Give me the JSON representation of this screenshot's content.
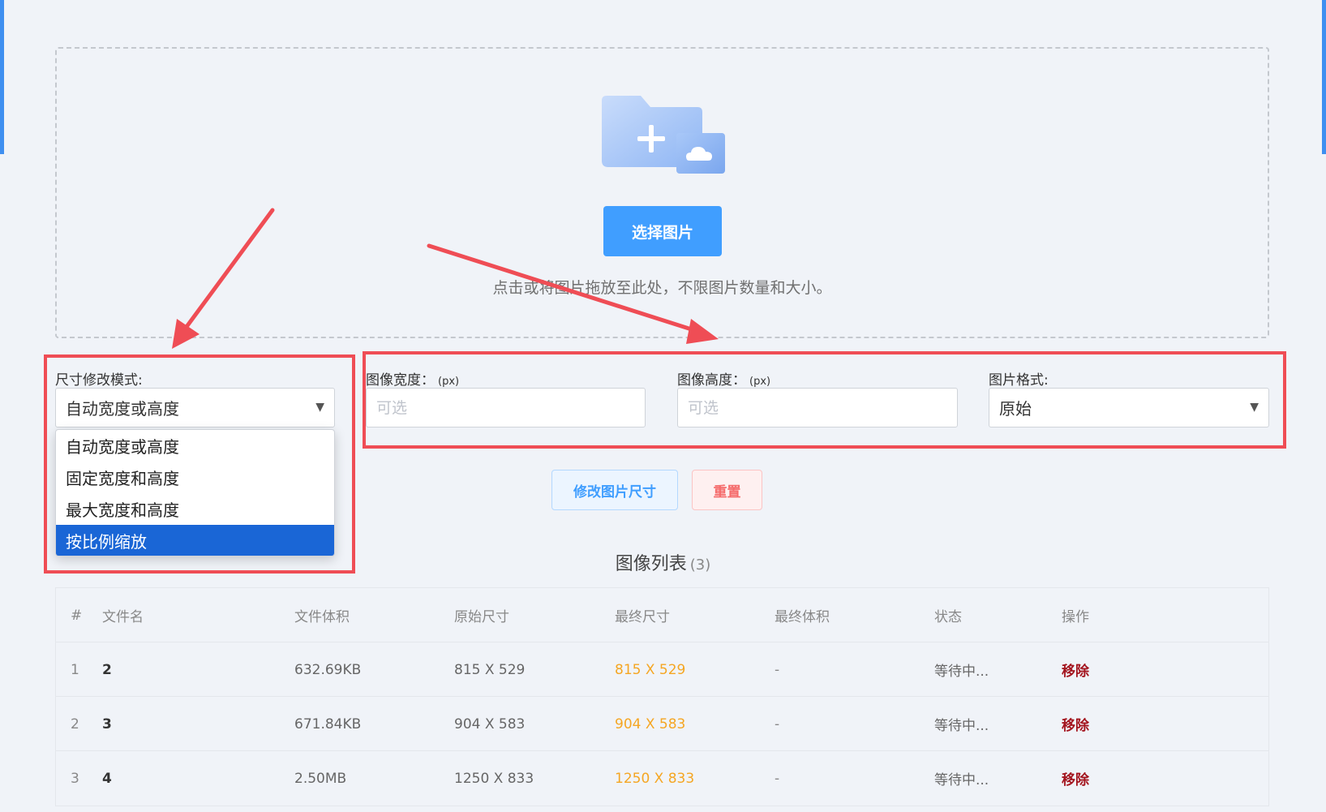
{
  "upload": {
    "select_button": "选择图片",
    "hint": "点击或将图片拖放至此处，不限图片数量和大小。",
    "icon": "folder-add-cloud-icon"
  },
  "settings": {
    "mode_label": "尺寸修改模式:",
    "mode_value": "自动宽度或高度",
    "mode_options": [
      "自动宽度或高度",
      "固定宽度和高度",
      "最大宽度和高度",
      "按比例缩放"
    ],
    "mode_highlighted": "按比例缩放",
    "width_label": "图像宽度：",
    "width_unit": "(px)",
    "width_placeholder": "可选",
    "height_label": "图像高度：",
    "height_unit": "(px)",
    "height_placeholder": "可选",
    "format_label": "图片格式:",
    "format_value": "原始"
  },
  "actions": {
    "resize_label": "修改图片尺寸",
    "reset_label": "重置"
  },
  "list": {
    "title": "图像列表",
    "count": "(3)",
    "headers": [
      "#",
      "文件名",
      "文件体积",
      "原始尺寸",
      "最终尺寸",
      "最终体积",
      "状态",
      "操作"
    ],
    "rows": [
      {
        "idx": "1",
        "name": "2",
        "size": "632.69KB",
        "orig": "815 X 529",
        "final": "815 X 529",
        "fsize": "-",
        "status": "等待中...",
        "op": "移除"
      },
      {
        "idx": "2",
        "name": "3",
        "size": "671.84KB",
        "orig": "904 X 583",
        "final": "904 X 583",
        "fsize": "-",
        "status": "等待中...",
        "op": "移除"
      },
      {
        "idx": "3",
        "name": "4",
        "size": "2.50MB",
        "orig": "1250 X 833",
        "final": "1250 X 833",
        "fsize": "-",
        "status": "等待中...",
        "op": "移除"
      }
    ]
  },
  "colors": {
    "primary": "#409eff",
    "danger": "#f56c6c",
    "annotation_red": "#ef4d55",
    "final_size": "#f5a623",
    "remove": "#a3141e",
    "option_selected": "#1a66d6"
  }
}
